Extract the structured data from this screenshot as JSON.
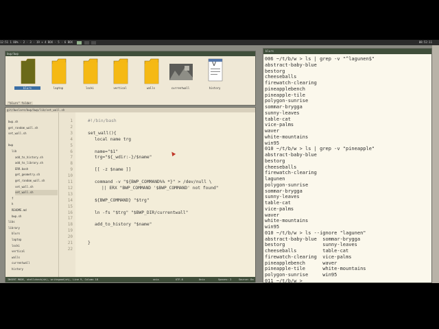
{
  "topbar": {
    "left_text": "12:51 1 80% · 2 · 3 · 19 + 4 BOX · 5 · 6 BOX",
    "right_text": "08:52:11"
  },
  "file_manager": {
    "path": "bwp/bwp",
    "status": "\"blurs\" folder",
    "items": [
      {
        "label": "blurs",
        "icon": "folder-icon",
        "selected": true
      },
      {
        "label": "laptop",
        "icon": "folder-icon",
        "selected": false
      },
      {
        "label": "locki",
        "icon": "folder-icon",
        "selected": false
      },
      {
        "label": "vertical",
        "icon": "folder-icon",
        "selected": false
      },
      {
        "label": "walls",
        "icon": "folder-icon",
        "selected": false
      },
      {
        "label": "currentwall",
        "icon": "image-thumbnail-icon",
        "selected": false
      },
      {
        "label": "history",
        "icon": "text-file-icon",
        "selected": false
      }
    ]
  },
  "editor": {
    "path": "git/bwclare/bwp/bwp/lib/set_wall.sh",
    "tree": [
      {
        "label": "bwp.sh",
        "indent": 0
      },
      {
        "label": "get_random_wall.sh",
        "indent": 0
      },
      {
        "label": "set_wall.sh",
        "indent": 0
      },
      {
        "label": "",
        "indent": 0
      },
      {
        "label": "bwp",
        "indent": 0
      },
      {
        "label": "lib",
        "indent": 1
      },
      {
        "label": "add_to_history.sh",
        "indent": 2
      },
      {
        "label": "add_to_library.sh",
        "indent": 2
      },
      {
        "label": "ERR.bash",
        "indent": 2
      },
      {
        "label": "get_geometry.sh",
        "indent": 2
      },
      {
        "label": "get_random_wall.sh",
        "indent": 2
      },
      {
        "label": "set_wall.sh",
        "indent": 2
      },
      {
        "label": "set_wall.sh",
        "indent": 2,
        "selected": true
      },
      {
        "label": "f",
        "indent": 1
      },
      {
        "label": "h",
        "indent": 1
      },
      {
        "label": "README.md",
        "indent": 1
      },
      {
        "label": "bwp.sh",
        "indent": 1
      },
      {
        "label": "libs",
        "indent": 0
      },
      {
        "label": "library",
        "indent": 0
      },
      {
        "label": "blurs",
        "indent": 1
      },
      {
        "label": "laptop",
        "indent": 1
      },
      {
        "label": "locki",
        "indent": 1
      },
      {
        "label": "vertical",
        "indent": 1
      },
      {
        "label": "walls",
        "indent": 1
      },
      {
        "label": "currentwall",
        "indent": 1
      },
      {
        "label": "history",
        "indent": 1
      }
    ],
    "code": [
      {
        "n": "1",
        "text": "#!/bin/bash",
        "indent": 0,
        "comment": true
      },
      {
        "n": "2",
        "text": "",
        "indent": 0
      },
      {
        "n": "3",
        "text": "set_wall(){",
        "indent": 0
      },
      {
        "n": "4",
        "text": "local name trg",
        "indent": 1
      },
      {
        "n": "5",
        "text": "",
        "indent": 0
      },
      {
        "n": "6",
        "text": "name=\"$1\"",
        "indent": 1
      },
      {
        "n": "7",
        "text": "trg=\"${_wdir:-}/$name\"",
        "indent": 1
      },
      {
        "n": "8",
        "text": "",
        "indent": 0
      },
      {
        "n": "9",
        "text": "[[ -z $name ]] ",
        "indent": 1
      },
      {
        "n": "10",
        "text": "",
        "indent": 0
      },
      {
        "n": "11",
        "text": "command -v \"${BWP_COMMAND%% *}\" > /dev/null \\",
        "indent": 1
      },
      {
        "n": "12",
        "text": "|| ERX \"BWP_COMMAND '$BWP_COMMAND' not found\"",
        "indent": 2
      },
      {
        "n": "13",
        "text": "",
        "indent": 0
      },
      {
        "n": "14",
        "text": "${BWP_COMMAND} \"$trg\"",
        "indent": 1
      },
      {
        "n": "15",
        "text": "",
        "indent": 0
      },
      {
        "n": "16",
        "text": "ln -fs \"$trg\" \"$BWP_DIR/currentwall\"",
        "indent": 1
      },
      {
        "n": "17",
        "text": "",
        "indent": 0
      },
      {
        "n": "18",
        "text": "add_to_history \"$name\"",
        "indent": 1
      },
      {
        "n": "19",
        "text": "",
        "indent": 0
      },
      {
        "n": "20",
        "text": "",
        "indent": 0
      },
      {
        "n": "21",
        "text": "}",
        "indent": 0
      },
      {
        "n": "22",
        "text": "",
        "indent": 0
      }
    ],
    "status": {
      "mode": "INSERT MODE, shellcheck(sh), writegood(sh), Line 9, Column 18",
      "encoding": "unix",
      "filetype": "UTF-8",
      "format": "Unix",
      "spaces": "Spaces: 2",
      "source": "Source: Ba"
    }
  },
  "terminal": {
    "title": "blurs",
    "lines": [
      "006 ~/t/b/w > ls | grep -v \"^lagunen$\"",
      "abstract-baby-blue",
      "bestorg",
      "cheeseballs",
      "firewatch-clearing",
      "pineapplebench",
      "pineapple-tile",
      "polygon-sunrise",
      "sommar-brygga",
      "sunny-leaves",
      "table-cat",
      "vice-palms",
      "waver",
      "white-mountains",
      "win95",
      "010 ~/t/b/w > ls | grep -v \"pineapple\"",
      "abstract-baby-blue",
      "bestorg",
      "cheeseballs",
      "firewatch-clearing",
      "lagunen",
      "polygon-sunrise",
      "sommar-brygga",
      "sunny-leaves",
      "table-cat",
      "vice-palms",
      "waver",
      "white-mountains",
      "win95",
      "010 ~/t/b/w > ls --ignore \"lagunen\"",
      "abstract-baby-blue  sommar-brygga",
      "bestorg             sunny-leaves",
      "cheeseballs         table-cat",
      "firewatch-clearing  vice-palms",
      "pineapplebench      waver",
      "pineapple-tile      white-mountains",
      "polygon-sunrise     win95",
      "011 ~/t/b/w > "
    ]
  },
  "colors": {
    "titlebar": "#3f4e3a",
    "editor_bg": "#f3edd9",
    "terminal_bg": "#fbf8ec",
    "folder": "#f5b814",
    "folder_selected": "#6b6a1a"
  }
}
